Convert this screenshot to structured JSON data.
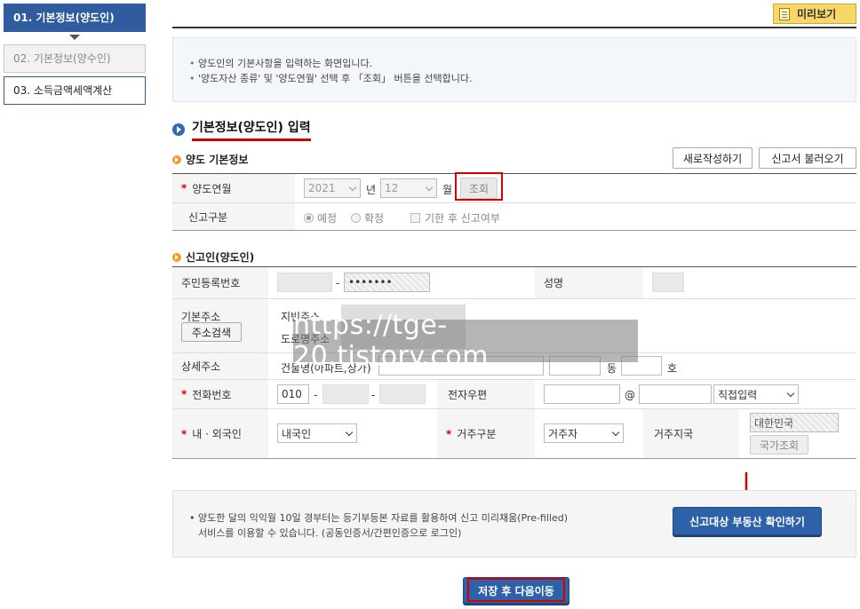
{
  "steps": [
    {
      "label": "01. 기본정보(양도인)"
    },
    {
      "label": "02. 기본정보(양수인)"
    },
    {
      "label": "03. 소득금액세액계산"
    }
  ],
  "preview_label": "미리보기",
  "info": [
    "양도인의 기본사항을 입력하는 화면입니다.",
    "'양도자산 종류' 및 '양도연월' 선택 후 「조회」 버튼을 선택합니다."
  ],
  "section_title": "기본정보(양도인) 입력",
  "transfer": {
    "title": "양도 기본정보",
    "new_btn": "새로작성하기",
    "load_btn": "신고서 불러오기",
    "period_label": "양도연월",
    "year": "2021",
    "year_unit": "년",
    "month": "12",
    "month_unit": "월",
    "query_btn": "조회",
    "type_label": "신고구분",
    "opt1": "예정",
    "opt2": "확정",
    "late_label": "기한 후 신고여부"
  },
  "reporter": {
    "title": "신고인(양도인)",
    "rrn_label": "주민등록번호",
    "rrn_dash": "-",
    "rrn_back": "•••••••",
    "name_label": "성명",
    "addr_label": "기본주소",
    "addr_search_btn": "주소검색",
    "jibun_label": "지번주소",
    "road_label": "도로명주소",
    "detail_label": "상세주소",
    "building_label": "건물명(아파트,상가)",
    "dong": "동",
    "ho": "호",
    "phone_label": "전화번호",
    "phone1": "010",
    "phone_dash1": "-",
    "phone_dash2": "-",
    "email_label": "전자우편",
    "at": "@",
    "email_domain": "직접입력",
    "nationality_label": "내 · 외국인",
    "nationality": "내국인",
    "residence_label": "거주구분",
    "residence": "거주자",
    "country_label": "거주지국",
    "country_value": "대한민국",
    "country_btn": "국가조회"
  },
  "bottom": {
    "notice_line1": "양도한 달의 익익월 10일 경부터는 등기부등본 자료를 활용하여 신고 미리채움(Pre-filled)",
    "notice_line2": "서비스를 이용할 수 있습니다. (공동인증서/간편인증으로 로그인)",
    "confirm_btn": "신고대상 부동산 확인하기",
    "save_btn": "저장 후 다음이동"
  },
  "watermark": "https://tge-20.tistory.com",
  "colors": {
    "accent": "#2e5c9e",
    "highlight": "#d60000",
    "preview": "#f7d768"
  }
}
